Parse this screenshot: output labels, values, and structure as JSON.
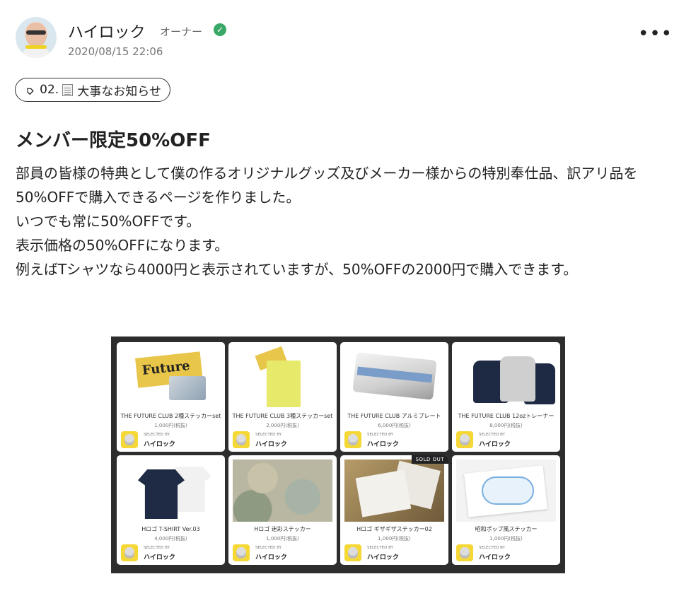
{
  "author": {
    "name": "ハイロック",
    "role": "オーナー",
    "timestamp": "2020/08/15 22:06"
  },
  "tag": {
    "number": "02.",
    "label": "大事なお知らせ"
  },
  "post": {
    "title": "メンバー限定50%OFF",
    "paragraphs": [
      "部員の皆様の特典として僕の作るオリジナルグッズ及びメーカー様からの特別奉仕品、訳アリ品を50%OFFで購入できるページを作りました。",
      "いつでも常に50%OFFです。",
      "表示価格の50%OFFになります。",
      "例えばTシャツなら4000円と表示されていますが、50%OFFの2000円で購入できます。"
    ]
  },
  "products": [
    {
      "name": "THE FUTURE CLUB 2種ステッカーset",
      "price": "1,000円(税抜)",
      "selected_by_label": "SELECTED BY",
      "selected_by": "ハイロック",
      "badge": ""
    },
    {
      "name": "THE FUTURE CLUB 3種ステッカーset",
      "price": "2,000円(税抜)",
      "selected_by_label": "SELECTED BY",
      "selected_by": "ハイロック",
      "badge": ""
    },
    {
      "name": "THE FUTURE CLUB アルミプレート",
      "price": "6,000円(税抜)",
      "selected_by_label": "SELECTED BY",
      "selected_by": "ハイロック",
      "badge": ""
    },
    {
      "name": "THE FUTURE CLUB 12ozトレーナー",
      "price": "8,000円(税抜)",
      "selected_by_label": "SELECTED BY",
      "selected_by": "ハイロック",
      "badge": ""
    },
    {
      "name": "Hロゴ T-SHIRT Ver.03",
      "price": "4,000円(税抜)",
      "selected_by_label": "SELECTED BY",
      "selected_by": "ハイロック",
      "badge": ""
    },
    {
      "name": "Hロゴ 迷彩ステッカー",
      "price": "1,000円(税抜)",
      "selected_by_label": "SELECTED BY",
      "selected_by": "ハイロック",
      "badge": ""
    },
    {
      "name": "Hロゴ ギザギザステッカー02",
      "price": "1,000円(税抜)",
      "selected_by_label": "SELECTED BY",
      "selected_by": "ハイロック",
      "badge": "SOLD OUT"
    },
    {
      "name": "昭和ポップ風ステッカー",
      "price": "1,000円(税抜)",
      "selected_by_label": "SELECTED BY",
      "selected_by": "ハイロック",
      "badge": ""
    }
  ],
  "thumb_texts": {
    "future": "Future"
  },
  "colors": {
    "verified": "#3aa866",
    "catalog_background": "#2d2d2d"
  }
}
